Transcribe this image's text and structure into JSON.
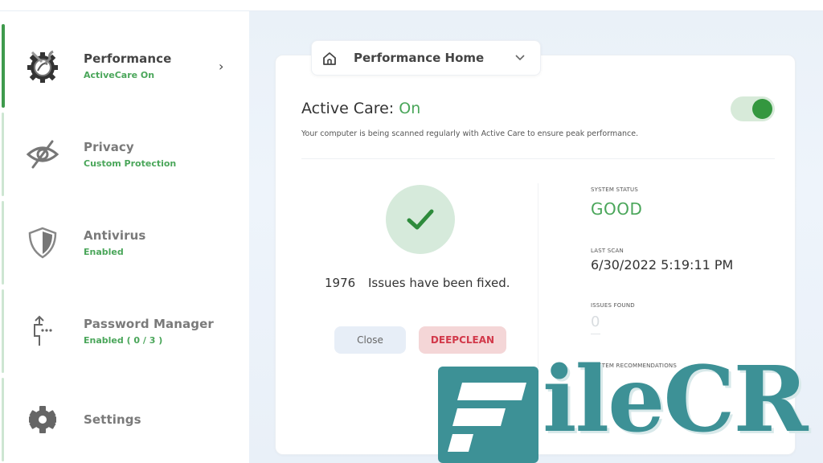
{
  "sidebar": {
    "items": [
      {
        "title": "Performance",
        "subtitle": "ActiveCare On",
        "icon": "performance-gear-icon",
        "active": true
      },
      {
        "title": "Privacy",
        "subtitle": "Custom Protection",
        "icon": "eye-slash-icon",
        "active": false
      },
      {
        "title": "Antivirus",
        "subtitle": "Enabled",
        "icon": "shield-icon",
        "active": false
      },
      {
        "title": "Password Manager",
        "subtitle": "Enabled ( 0 / 3 )",
        "icon": "password-manager-icon",
        "active": false
      },
      {
        "title": "Settings",
        "subtitle": "",
        "icon": "gear-icon",
        "active": false
      }
    ],
    "chevron": "›"
  },
  "dropdown": {
    "label": "Performance Home",
    "icon": "home-icon"
  },
  "active_care": {
    "title_prefix": "Active Care:",
    "status": "On",
    "description": "Your computer is being scanned regularly with Active Care to ensure peak performance.",
    "toggle_on": true
  },
  "result": {
    "count": "1976",
    "message": "Issues have been fixed.",
    "close_label": "Close",
    "deepclean_label": "DEEPCLEAN"
  },
  "stats": {
    "system_status_label": "SYSTEM STATUS",
    "system_status_value": "GOOD",
    "last_scan_label": "LAST SCAN",
    "last_scan_value": "6/30/2022 5:19:11 PM",
    "issues_found_label": "ISSUES FOUND",
    "issues_found_value": "0",
    "recommendations_label": "SYSTEM RECOMMENDATIONS"
  },
  "watermark": {
    "text": "ileCR"
  },
  "colors": {
    "accent_green": "#4aa65a",
    "toggle_green": "#34973f",
    "danger_red": "#d2394a",
    "watermark_teal": "#3d9196"
  }
}
